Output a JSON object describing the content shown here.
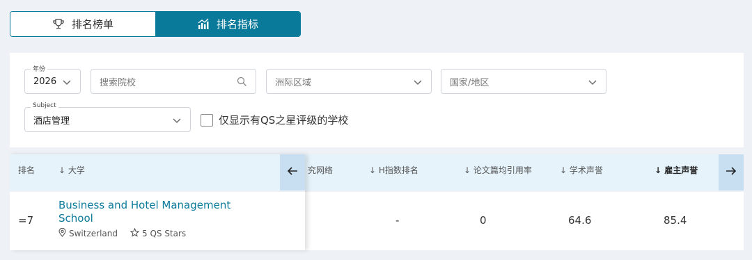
{
  "tabs": [
    {
      "label": "排名榜单",
      "icon": "trophy-icon"
    },
    {
      "label": "排名指标",
      "icon": "bar-chart-icon"
    }
  ],
  "filters": {
    "year_label": "年份",
    "year_value": "2026",
    "search_placeholder": "搜索院校",
    "continent_placeholder": "洲际区域",
    "country_placeholder": "国家/地区",
    "subject_label": "Subject",
    "subject_value": "酒店管理",
    "qs_stars_only_label": "仅显示有QS之星评级的学校"
  },
  "table": {
    "headers": {
      "rank": "排名",
      "university": "大学",
      "research_network": "究网络",
      "h_index": "H指数排名",
      "citations": "论文篇均引用率",
      "academic_reputation": "学术声誉",
      "employer_reputation": "雇主声誉"
    },
    "rows": [
      {
        "rank": "=7",
        "name": "Business and Hotel Management School",
        "country": "Switzerland",
        "stars": "5 QS Stars",
        "h_index": "-",
        "citations": "0",
        "academic_reputation": "64.6",
        "employer_reputation": "85.4"
      }
    ]
  },
  "colors": {
    "accent": "#0a7a9a",
    "header_bg": "#e6f3fb",
    "page_bg": "#eef2f7"
  }
}
